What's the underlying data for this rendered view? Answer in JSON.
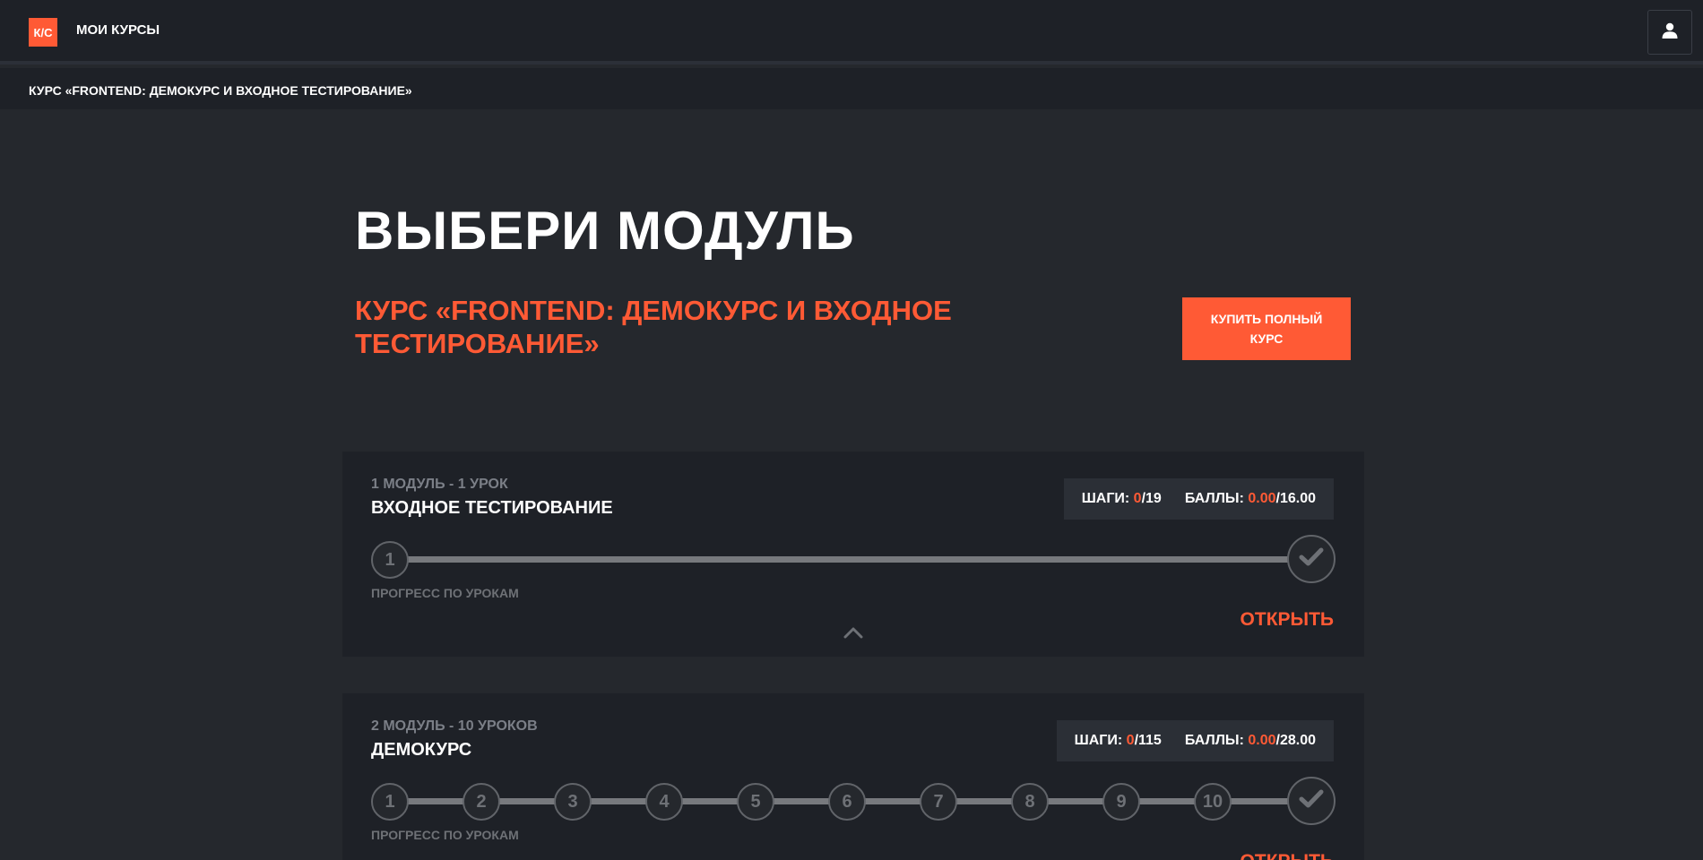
{
  "header": {
    "logo_text": "К/С",
    "my_courses": "МОИ КУРСЫ",
    "user_icon": "user-icon"
  },
  "breadcrumb": {
    "text": "КУРС «FRONTEND: ДЕМОКУРС И ВХОДНОЕ ТЕСТИРОВАНИЕ»"
  },
  "main": {
    "title": "ВЫБЕРИ МОДУЛЬ",
    "course_title": "КУРС «FRONTEND: ДЕМОКУРС И ВХОДНОЕ ТЕСТИРОВАНИЕ»",
    "buy_button": "КУПИТЬ ПОЛНЫЙ КУРС"
  },
  "colors": {
    "accent": "#ff5a35",
    "background": "#25282d",
    "panel": "#1e2127"
  },
  "modules": [
    {
      "meta": "1 МОДУЛЬ - 1 УРОК",
      "name": "ВХОДНОЕ ТЕСТИРОВАНИЕ",
      "steps_label": "ШАГИ:",
      "steps_done": "0",
      "steps_total": "/19",
      "points_label": "БАЛЛЫ:",
      "points_done": "0.00",
      "points_total": "/16.00",
      "lessons": [
        "1"
      ],
      "progress_label": "ПРОГРЕСС ПО УРОКАМ",
      "open_label": "ОТКРЫТЬ"
    },
    {
      "meta": "2 МОДУЛЬ - 10 УРОКОВ",
      "name": "ДЕМОКУРС",
      "steps_label": "ШАГИ:",
      "steps_done": "0",
      "steps_total": "/115",
      "points_label": "БАЛЛЫ:",
      "points_done": "0.00",
      "points_total": "/28.00",
      "lessons": [
        "1",
        "2",
        "3",
        "4",
        "5",
        "6",
        "7",
        "8",
        "9",
        "10"
      ],
      "progress_label": "ПРОГРЕСС ПО УРОКАМ",
      "open_label": "ОТКРЫТЬ"
    }
  ]
}
